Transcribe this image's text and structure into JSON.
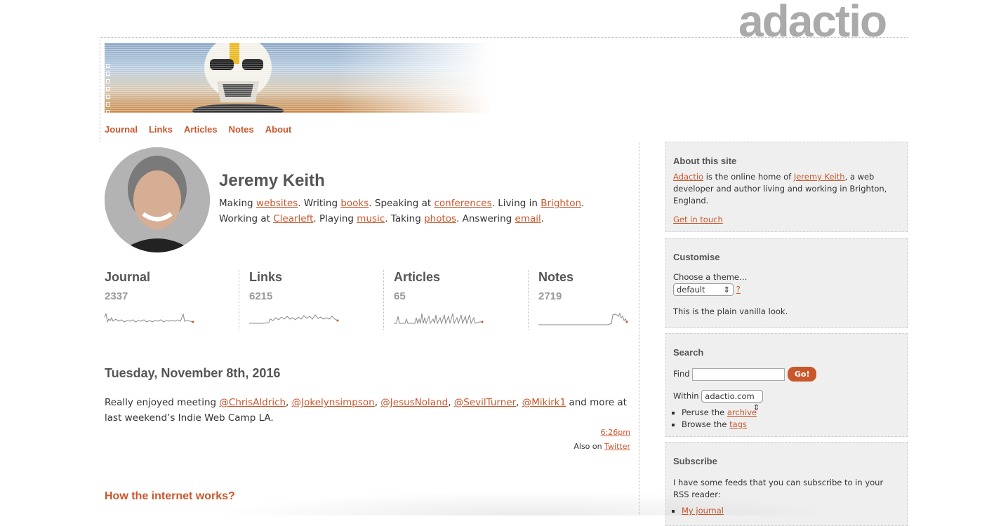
{
  "logo": "adactio",
  "nav": [
    "Journal",
    "Links",
    "Articles",
    "Notes",
    "About"
  ],
  "profile": {
    "name": "Jeremy Keith",
    "line1": [
      "Making ",
      "websites",
      ". Writing ",
      "books",
      ". Speaking at ",
      "conferences",
      ". Living in ",
      "Brighton",
      "."
    ],
    "line2": [
      "Working at ",
      "Clearleft",
      ". Playing ",
      "music",
      ". Taking ",
      "photos",
      ". Answering ",
      "email",
      "."
    ]
  },
  "stats": [
    {
      "label": "Journal",
      "count": "2337"
    },
    {
      "label": "Links",
      "count": "6215"
    },
    {
      "label": "Articles",
      "count": "65"
    },
    {
      "label": "Notes",
      "count": "2719"
    }
  ],
  "entry": {
    "date": "Tuesday, November 8th, 2016",
    "text_pre": "Really enjoyed meeting ",
    "mentions": [
      "@ChrisAldrich",
      "@Jokelynsimpson",
      "@JesusNoland",
      "@SevilTurner",
      "@Mikirk1"
    ],
    "text_post": " and more at last weekend’s Indie Web Camp LA.",
    "time": "6:26pm",
    "also_on": "Also on ",
    "also_link": "Twitter"
  },
  "next_title": "How the internet works?",
  "sidebar": {
    "about": {
      "title": "About this site",
      "link1": "Adactio",
      "text1": " is the online home of ",
      "link2": "Jeremy Keith",
      "text2": ", a web developer and author living and working in Brighton, England.",
      "contact": "Get in touch"
    },
    "customise": {
      "title": "Customise",
      "choose": "Choose a theme…",
      "theme": "default",
      "help": "?",
      "desc": "This is the plain vanilla look."
    },
    "search": {
      "title": "Search",
      "find": "Find",
      "go": "Go!",
      "within": "Within",
      "scope": "adactio.com",
      "peruse": "Peruse the ",
      "archive": "archive",
      "browse": "Browse the ",
      "tags": "tags"
    },
    "subscribe": {
      "title": "Subscribe",
      "text": "I have some feeds that you can subscribe to in your RSS reader:",
      "item1": "My journal"
    }
  },
  "colors": {
    "accent": "#c9572c",
    "logo": "#aaaaaa",
    "sidebar_bg": "#efefef"
  }
}
